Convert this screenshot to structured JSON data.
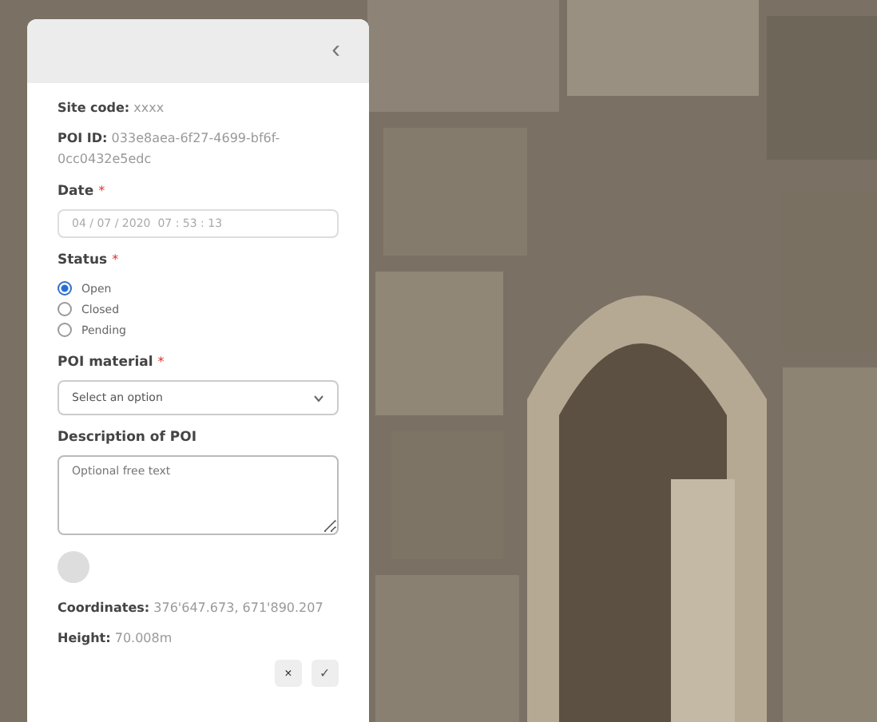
{
  "panel": {
    "collapse_icon": "‹",
    "info": [
      "**Site code:** xxxx",
      "**POI ID:** 033e8aea-6f27-4699-bf6f-0cc0432e5edc"
    ],
    "date": {
      "label": "Date",
      "mark": "*",
      "value": "04 / 07 / 2020  07 : 53 : 13"
    },
    "status": {
      "label": "Status",
      "mark": "*",
      "options": [
        {
          "label": "Open",
          "selected": true
        },
        {
          "label": "Closed",
          "selected": false
        },
        {
          "label": "Pending",
          "selected": false
        }
      ]
    },
    "material": {
      "label": "POI material",
      "mark": "*",
      "value": "Select an option"
    },
    "description": {
      "label": "Description of POI",
      "placeholder": "Optional free text"
    },
    "details": [
      "**Coordinates:** 376'647.673, 671'890.207",
      "**Height:** 70.008m"
    ],
    "buttons": [
      {
        "kind": "cancel",
        "label": "×"
      },
      {
        "kind": "confirm",
        "label": "✓"
      }
    ]
  }
}
